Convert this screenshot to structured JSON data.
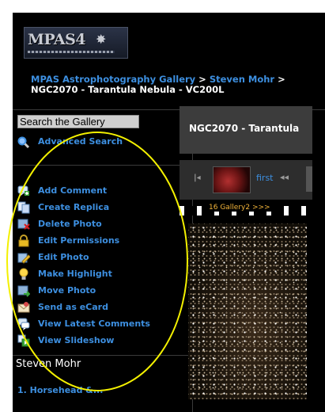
{
  "logo": {
    "text": "MPAS4",
    "alt": "MPAS logo"
  },
  "breadcrumb": {
    "gallery_link": "MPAS Astrophotography Gallery",
    "separator_1": " > ",
    "user_link": "Steven Mohr",
    "separator_2": " > ",
    "current": "NGC2070 - Tarantula Nebula - VC200L"
  },
  "search": {
    "value": "Search the Gallery",
    "advanced_label": "Advanced Search"
  },
  "actions": [
    {
      "label": "Add Comment",
      "icon": "comment-icon"
    },
    {
      "label": "Create Replica",
      "icon": "copy-icon"
    },
    {
      "label": "Delete Photo",
      "icon": "delete-icon"
    },
    {
      "label": "Edit Permissions",
      "icon": "lock-icon"
    },
    {
      "label": "Edit Photo",
      "icon": "pencil-icon"
    },
    {
      "label": "Make Highlight",
      "icon": "bulb-icon"
    },
    {
      "label": "Move Photo",
      "icon": "move-icon"
    },
    {
      "label": "Send as eCard",
      "icon": "envelope-icon"
    },
    {
      "label": "View Latest Comments",
      "icon": "comments-icon"
    },
    {
      "label": "View Slideshow",
      "icon": "slideshow-icon"
    }
  ],
  "owner": {
    "name": "Steven Mohr"
  },
  "albums": [
    {
      "label": "1. Horsehead &..."
    }
  ],
  "photo": {
    "title": "NGC2070 - Tarantula",
    "nav_first_label": "first",
    "gallery_label": "16 Gallery2 >>>"
  },
  "colors": {
    "link": "#3d8fe0",
    "annotation": "#f3f000",
    "background": "#000000"
  }
}
